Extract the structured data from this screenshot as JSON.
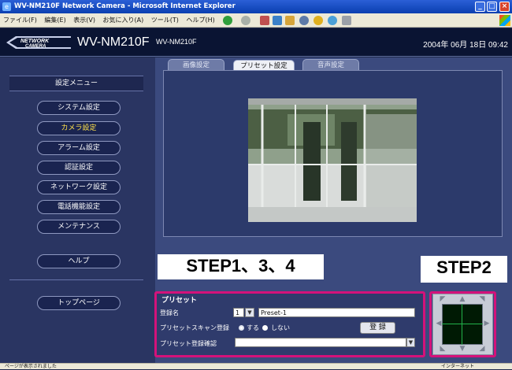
{
  "window": {
    "title": "WV-NM210F Network Camera - Microsoft Internet Explorer",
    "icon": "ie-icon",
    "buttons": [
      "minimize",
      "maximize",
      "close"
    ]
  },
  "menubar": {
    "items": [
      "ファイル(F)",
      "編集(E)",
      "表示(V)",
      "お気に入り(A)",
      "ツール(T)",
      "ヘルプ(H)"
    ]
  },
  "header": {
    "logo_line1": "NETWORK",
    "logo_line2": "CAMERA",
    "model": "WV-NM210F",
    "subtitle": "WV-NM210F",
    "datetime": "2004年 06月 18日 09:42"
  },
  "sidebar": {
    "heading": "設定メニュー",
    "items": [
      {
        "label": "システム設定",
        "active": false
      },
      {
        "label": "カメラ設定",
        "active": true
      },
      {
        "label": "アラーム設定",
        "active": false
      },
      {
        "label": "認証設定",
        "active": false
      },
      {
        "label": "ネットワーク設定",
        "active": false
      },
      {
        "label": "電話機能設定",
        "active": false
      },
      {
        "label": "メンテナンス",
        "active": false
      }
    ],
    "help": "ヘルプ",
    "top_page": "トップページ"
  },
  "tabs": [
    {
      "label": "画像設定",
      "active": false
    },
    {
      "label": "プリセット設定",
      "active": true
    },
    {
      "label": "音声設定",
      "active": false
    }
  ],
  "preset": {
    "title": "プリセット",
    "name_label": "登録名",
    "number_value": "1",
    "name_value": "Preset-1",
    "scan_label": "プリセットスキャン登録",
    "scan_on": "する",
    "scan_off": "しない",
    "register_button": "登 録",
    "confirm_label": "プリセット登録確認",
    "confirm_value": ""
  },
  "steps": {
    "step_a": "STEP1、3、4",
    "step_b": "STEP2"
  },
  "status": {
    "left": "ページが表示されました",
    "right": "インターネット"
  },
  "colors": {
    "highlight": "#d4127a",
    "background": "#2a3562",
    "header": "#0a1433",
    "active_menu": "#ffe24a"
  }
}
